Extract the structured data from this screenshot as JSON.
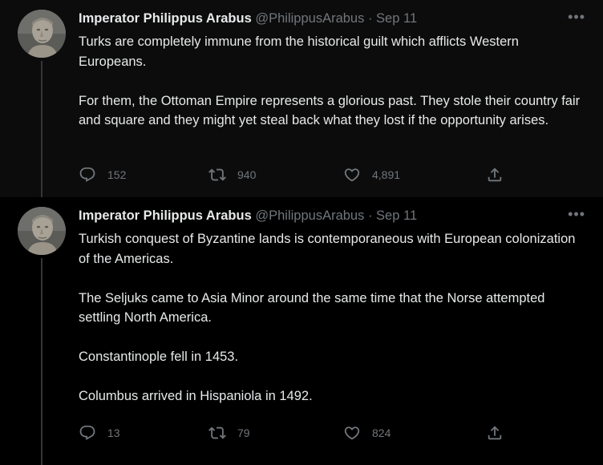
{
  "colors": {
    "background": "#000000",
    "highlight_background": "#0c0c0c",
    "text_primary": "#e7e9ea",
    "text_secondary": "#71767b",
    "thread_line": "#333639"
  },
  "tweets": [
    {
      "author": {
        "display_name": "Imperator Philippus Arabus",
        "handle": "@PhilippusArabus",
        "avatar_icon": "bust-avatar"
      },
      "separator": "·",
      "date": "Sep 11",
      "more_label": "•••",
      "paragraphs": [
        "Turks are completely immune from the historical guilt which afflicts Western Europeans.",
        "For them, the Ottoman Empire represents a glorious past. They stole their country fair and square and they might yet steal back what they lost if the opportunity arises."
      ],
      "stats": {
        "replies": "152",
        "retweets": "940",
        "likes": "4,891"
      }
    },
    {
      "author": {
        "display_name": "Imperator Philippus Arabus",
        "handle": "@PhilippusArabus",
        "avatar_icon": "bust-avatar"
      },
      "separator": "·",
      "date": "Sep 11",
      "more_label": "•••",
      "paragraphs": [
        "Turkish conquest of Byzantine lands is contemporaneous with European colonization of the Americas.",
        "The Seljuks came to Asia Minor around the same time that the Norse attempted settling North America.",
        "Constantinople fell in 1453.",
        "Columbus arrived in Hispaniola in 1492."
      ],
      "stats": {
        "replies": "13",
        "retweets": "79",
        "likes": "824"
      }
    }
  ]
}
